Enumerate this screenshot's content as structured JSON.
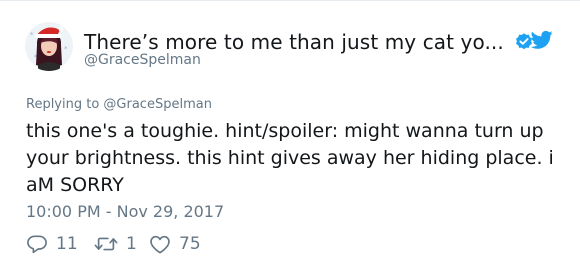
{
  "tweet": {
    "display_name": "There’s more to me than just my cat yo...",
    "handle": "@GraceSpelman",
    "replying_to": "Replying to @GraceSpelman",
    "text": "this one's a toughie. hint/spoiler: might wanna turn up your brightness. this hint gives away her hiding place. i aM SORRY",
    "timestamp": "10:00 PM - Nov 29, 2017",
    "icons": {
      "verified": "verified-badge-icon",
      "brand": "twitter-bird-icon",
      "reply": "reply-icon",
      "retweet": "retweet-icon",
      "like": "heart-icon"
    }
  },
  "actions": {
    "reply_count": "11",
    "retweet_count": "1",
    "like_count": "75"
  },
  "colors": {
    "accent": "#1da1f2",
    "muted": "#657786",
    "text": "#14171a"
  }
}
